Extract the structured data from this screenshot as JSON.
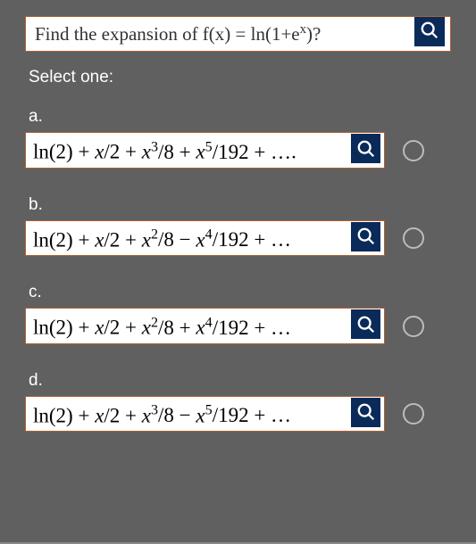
{
  "question": {
    "text": "Find the expansion of f(x) = ln(1+eˣ)?",
    "text_html": "Find the expansion of f(x) = ln(1+e<sup>x</sup>)?"
  },
  "prompt": "Select one:",
  "options": [
    {
      "letter": "a.",
      "formula": "ln(2) + x/2 + x³/8 + x⁵/192 + …",
      "formula_html": "<span class='rm'> ln(2) + </span>x<span class='rm'>/2 + </span>x<span class='rm'><sup>3</sup>/8 + </span>x<span class='rm'><sup>5</sup>/192 +&nbsp;…</span><span class='rm'>.</span>"
    },
    {
      "letter": "b.",
      "formula": "ln(2) + x/2 + x²/8 − x⁴/192 + …",
      "formula_html": "<span class='rm'>ln(2) + </span>x<span class='rm'>/2 + </span>x<span class='rm'><sup>2</sup>/8 − </span>x<span class='rm'><sup>4</sup>/192 +&nbsp;…</span>"
    },
    {
      "letter": "c.",
      "formula": "ln(2) + x/2 + x²/8 + x⁴/192 + …",
      "formula_html": "<span class='rm'>ln(2) + </span>x<span class='rm'>/2 + </span>x<span class='rm'><sup>2</sup>/8 + </span>x<span class='rm'><sup>4</sup>/192 +&nbsp;…</span>"
    },
    {
      "letter": "d.",
      "formula": "ln(2) + x/2 + x³/8 − x⁵/192 + …",
      "formula_html": "<span class='rm'>ln(2) + </span>x<span class='rm'>/2 + </span>x<span class='rm'><sup>3</sup>/8 − </span>x<span class='rm'><sup>5</sup>/192 +&nbsp;…</span>"
    }
  ],
  "icons": {
    "mag": "magnifier-icon"
  }
}
